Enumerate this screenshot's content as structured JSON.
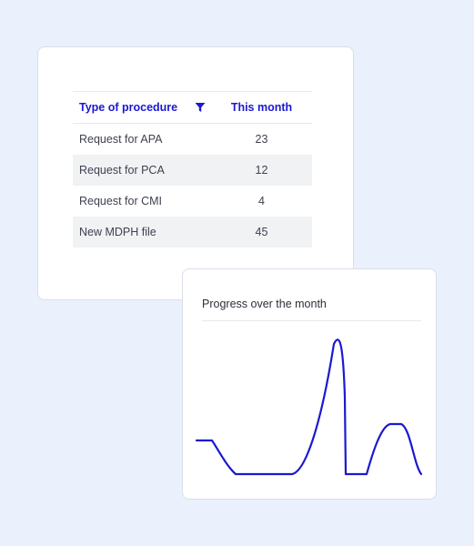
{
  "table": {
    "header_procedure": "Type of procedure",
    "header_month": "This month",
    "filter_icon": "filter-icon",
    "rows": [
      {
        "procedure": "Request for APA",
        "value": "23"
      },
      {
        "procedure": "Request for PCA",
        "value": "12"
      },
      {
        "procedure": "Request for CMI",
        "value": "4"
      },
      {
        "procedure": "New MDPH file",
        "value": "45"
      }
    ]
  },
  "chart": {
    "title": "Progress over the month",
    "line_color": "#1b19d0"
  },
  "colors": {
    "accent": "#1b19d0",
    "background": "#eaf0fc",
    "row_alt": "#f1f2f4"
  }
}
